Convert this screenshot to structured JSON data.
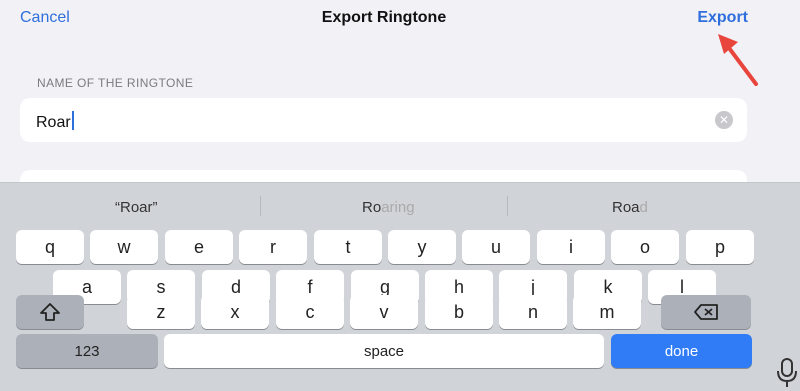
{
  "nav": {
    "cancel": "Cancel",
    "title": "Export Ringtone",
    "export": "Export"
  },
  "form": {
    "section_label": "NAME OF THE RINGTONE",
    "name_value": "Roar",
    "clear_icon": "clear-circle-icon"
  },
  "suggestions": [
    {
      "text": "“Roar”",
      "faded": ""
    },
    {
      "text": "Ro",
      "faded": "aring"
    },
    {
      "text": "Roa",
      "faded": "d"
    }
  ],
  "keyboard": {
    "row1": [
      "q",
      "w",
      "e",
      "r",
      "t",
      "y",
      "u",
      "i",
      "o",
      "p"
    ],
    "row2": [
      "a",
      "s",
      "d",
      "f",
      "g",
      "h",
      "j",
      "k",
      "l"
    ],
    "row3": [
      "z",
      "x",
      "c",
      "v",
      "b",
      "n",
      "m"
    ],
    "shift_icon": "shift-icon",
    "delete_icon": "delete-backward-icon",
    "numbers_label": "123",
    "space_label": "space",
    "done_label": "done",
    "mic_icon": "microphone-icon"
  },
  "colors": {
    "accent": "#2f6fdc",
    "annotation": "#e8453c",
    "done_key": "#2f7cf6"
  }
}
